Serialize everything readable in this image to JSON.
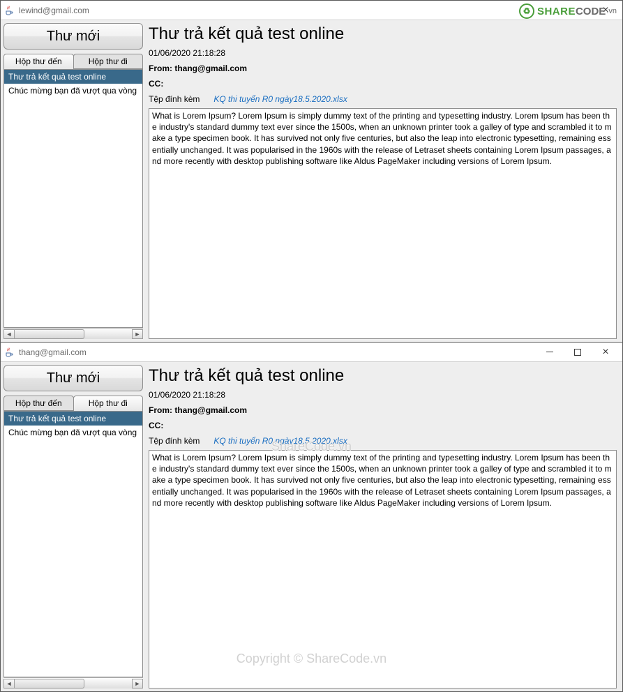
{
  "watermarks": {
    "logo_share": "SHARE",
    "logo_code": "CODE",
    "logo_vn": ".vn",
    "mid_text": "ShareCode.vn",
    "bottom_text": "Copyright © ShareCode.vn"
  },
  "windows": [
    {
      "title": "lewind@gmail.com",
      "has_window_controls": false,
      "close_visible": true,
      "new_mail_label": "Thư mới",
      "tabs": [
        {
          "label": "Hộp thư đến",
          "active": true
        },
        {
          "label": "Hộp thư đi",
          "active": false
        }
      ],
      "mails": [
        {
          "subject": "Thư trả kết quả test online",
          "selected": true
        },
        {
          "subject": "Chúc mừng bạn đã vượt qua vòng",
          "selected": false
        }
      ],
      "detail": {
        "subject": "Thư trả kết quả test online",
        "timestamp": "01/06/2020 21:18:28",
        "from_label": "From: ",
        "from_value": "thang@gmail.com",
        "cc_label": "CC:",
        "cc_value": "",
        "attach_label": "Tệp đính kèm",
        "attach_file": "KQ thi tuyển R0 ngày18.5.2020.xlsx",
        "body": "What is Lorem Ipsum?\nLorem Ipsum is simply dummy text of the printing and typesetting industry. Lorem Ipsum has been the industry's standard dummy text ever since the 1500s, when an unknown printer took a galley of type and scrambled it to make a type specimen book. It has survived not only five centuries, but also the leap into electronic typesetting, remaining essentially unchanged. It was popularised in the 1960s with the release of Letraset sheets containing Lorem Ipsum passages, and more recently with desktop publishing software like Aldus PageMaker including versions of Lorem Ipsum."
      }
    },
    {
      "title": "thang@gmail.com",
      "has_window_controls": true,
      "close_visible": true,
      "new_mail_label": "Thư mới",
      "tabs": [
        {
          "label": "Hộp thư đến",
          "active": false
        },
        {
          "label": "Hộp thư đi",
          "active": true
        }
      ],
      "mails": [
        {
          "subject": "Thư trả kết quả test online",
          "selected": true
        },
        {
          "subject": "Chúc mừng bạn đã vượt qua vòng",
          "selected": false
        }
      ],
      "detail": {
        "subject": "Thư trả kết quả test online",
        "timestamp": "01/06/2020 21:18:28",
        "from_label": "From: ",
        "from_value": "thang@gmail.com",
        "cc_label": "CC:",
        "cc_value": "",
        "attach_label": "Tệp đính kèm",
        "attach_file": "KQ thi tuyển R0 ngày18.5.2020.xlsx",
        "body": "What is Lorem Ipsum?\nLorem Ipsum is simply dummy text of the printing and typesetting industry. Lorem Ipsum has been the industry's standard dummy text ever since the 1500s, when an unknown printer took a galley of type and scrambled it to make a type specimen book. It has survived not only five centuries, but also the leap into electronic typesetting, remaining essentially unchanged. It was popularised in the 1960s with the release of Letraset sheets containing Lorem Ipsum passages, and more recently with desktop publishing software like Aldus PageMaker including versions of Lorem Ipsum."
      }
    }
  ]
}
